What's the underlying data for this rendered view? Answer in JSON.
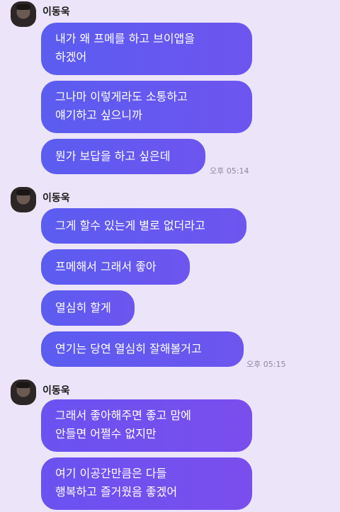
{
  "groups": [
    {
      "sender": "이동욱",
      "messages": [
        "내가 왜 프메를 하고 브이앱을\n하겠어",
        "그나마 이렇게라도 소통하고\n얘기하고 싶으니까",
        "뭔가 보답을 하고 싶은데"
      ],
      "time": "오후 05:14"
    },
    {
      "sender": "이동욱",
      "messages": [
        "그게 할수 있는게 별로 없더라고",
        "프메해서 그래서 좋아",
        "열심히 할게",
        "연기는 당연 열심히 잘해볼거고"
      ],
      "time": "오후 05:15"
    },
    {
      "sender": "이동욱",
      "messages": [
        "그래서 좋아해주면 좋고 맘에\n안들면 어쩔수 없지만",
        "여기 이공간만큼은 다들\n행복하고 즐거웠음 좋겠어"
      ]
    }
  ]
}
